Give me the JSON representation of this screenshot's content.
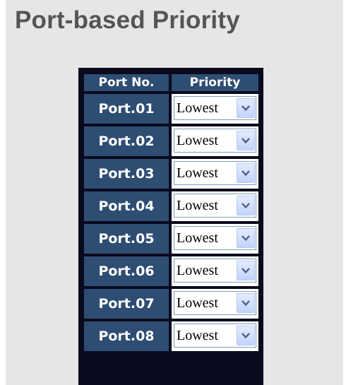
{
  "page": {
    "title": "Port-based Priority"
  },
  "table": {
    "headers": {
      "port": "Port No.",
      "priority": "Priority"
    },
    "rows": [
      {
        "port": "Port.01",
        "priority": "Lowest"
      },
      {
        "port": "Port.02",
        "priority": "Lowest"
      },
      {
        "port": "Port.03",
        "priority": "Lowest"
      },
      {
        "port": "Port.04",
        "priority": "Lowest"
      },
      {
        "port": "Port.05",
        "priority": "Lowest"
      },
      {
        "port": "Port.06",
        "priority": "Lowest"
      },
      {
        "port": "Port.07",
        "priority": "Lowest"
      },
      {
        "port": "Port.08",
        "priority": "Lowest"
      }
    ]
  },
  "colors": {
    "panel_background": "#e6e6e6",
    "title_text": "#555555",
    "header_cell": "#2e4d72",
    "table_border": "#0a0a1e",
    "dropdown_arrow": "#4d6185"
  },
  "icons": {
    "dropdown": "chevron-down-icon"
  }
}
